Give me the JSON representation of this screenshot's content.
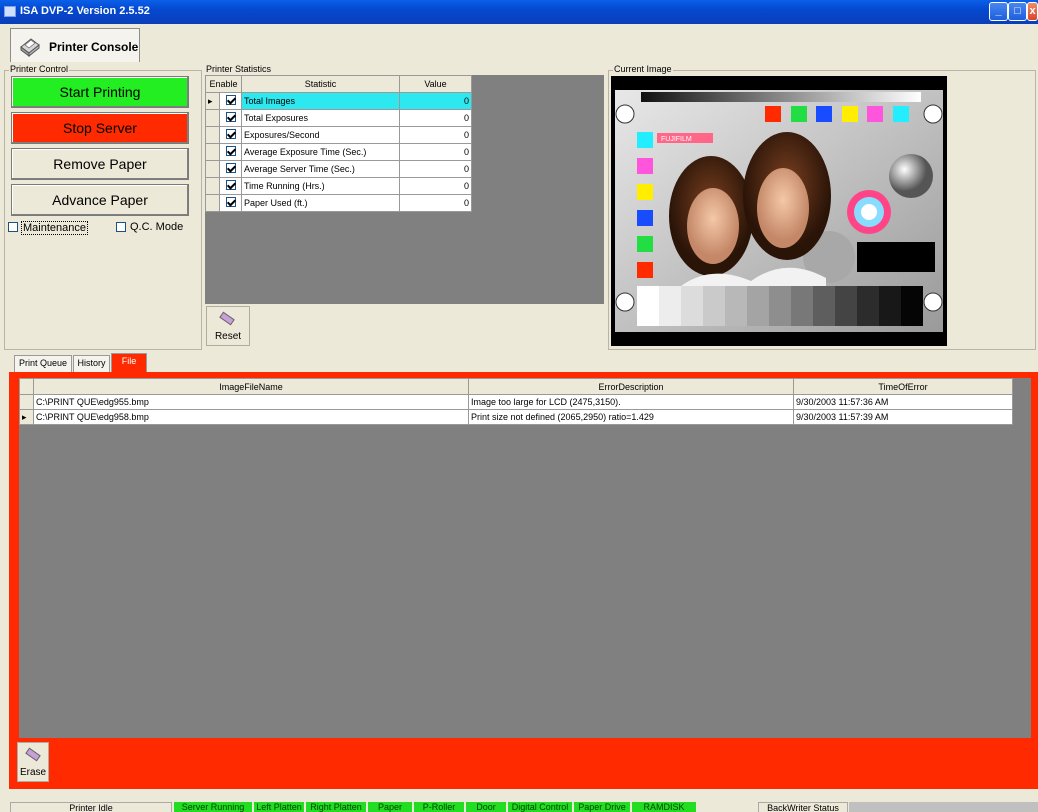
{
  "window": {
    "title": "ISA DVP-2 Version 2.5.52"
  },
  "console_tab": {
    "label": "Printer Console"
  },
  "printer_control": {
    "group_title": "Printer Control",
    "buttons": [
      {
        "label": "Start Printing",
        "color": "#22ee22"
      },
      {
        "label": "Stop Server",
        "color": "#ff2a00"
      },
      {
        "label": "Remove Paper",
        "color": "#ece9d8"
      },
      {
        "label": "Advance Paper",
        "color": "#ece9d8"
      }
    ],
    "maintenance_label": "Maintenance",
    "qc_label": "Q.C. Mode"
  },
  "printer_statistics": {
    "group_title": "Printer Statistics",
    "headers": {
      "enable": "Enable",
      "statistic": "Statistic",
      "value": "Value"
    },
    "rows": [
      {
        "statistic": "Total Images",
        "value": "0"
      },
      {
        "statistic": "Total Exposures",
        "value": "0"
      },
      {
        "statistic": "Exposures/Second",
        "value": "0"
      },
      {
        "statistic": "Average Exposure Time (Sec.)",
        "value": "0"
      },
      {
        "statistic": "Average Server Time (Sec.)",
        "value": "0"
      },
      {
        "statistic": "Time Running (Hrs.)",
        "value": "0"
      },
      {
        "statistic": "Paper Used (ft.)",
        "value": "0"
      }
    ],
    "reset_label": "Reset"
  },
  "current_image": {
    "group_title": "Current Image",
    "logo_text": "FUJIFILM"
  },
  "tabs": [
    {
      "label": "Print Queue"
    },
    {
      "label": "History"
    },
    {
      "label": "File Errors"
    }
  ],
  "file_errors": {
    "headers": {
      "file": "ImageFileName",
      "desc": "ErrorDescription",
      "time": "TimeOfError"
    },
    "rows": [
      {
        "file": "C:\\PRINT QUE\\edg955.bmp",
        "desc": "Image too large for LCD (2475,3150).",
        "time": "9/30/2003 11:57:36 AM"
      },
      {
        "file": "C:\\PRINT QUE\\edg958.bmp",
        "desc": "Print size not defined (2065,2950) ratio=1.429",
        "time": "9/30/2003 11:57:39 AM"
      }
    ],
    "erase_label": "Erase"
  },
  "statusbar": {
    "idle": "Printer Idle",
    "indicators": [
      "Server Running",
      "Left Platten",
      "Right Platten",
      "Paper",
      "P-Roller",
      "Door",
      "Digital Control",
      "Paper Drive",
      "RAMDISK"
    ],
    "backwriter": "BackWriter Status"
  }
}
